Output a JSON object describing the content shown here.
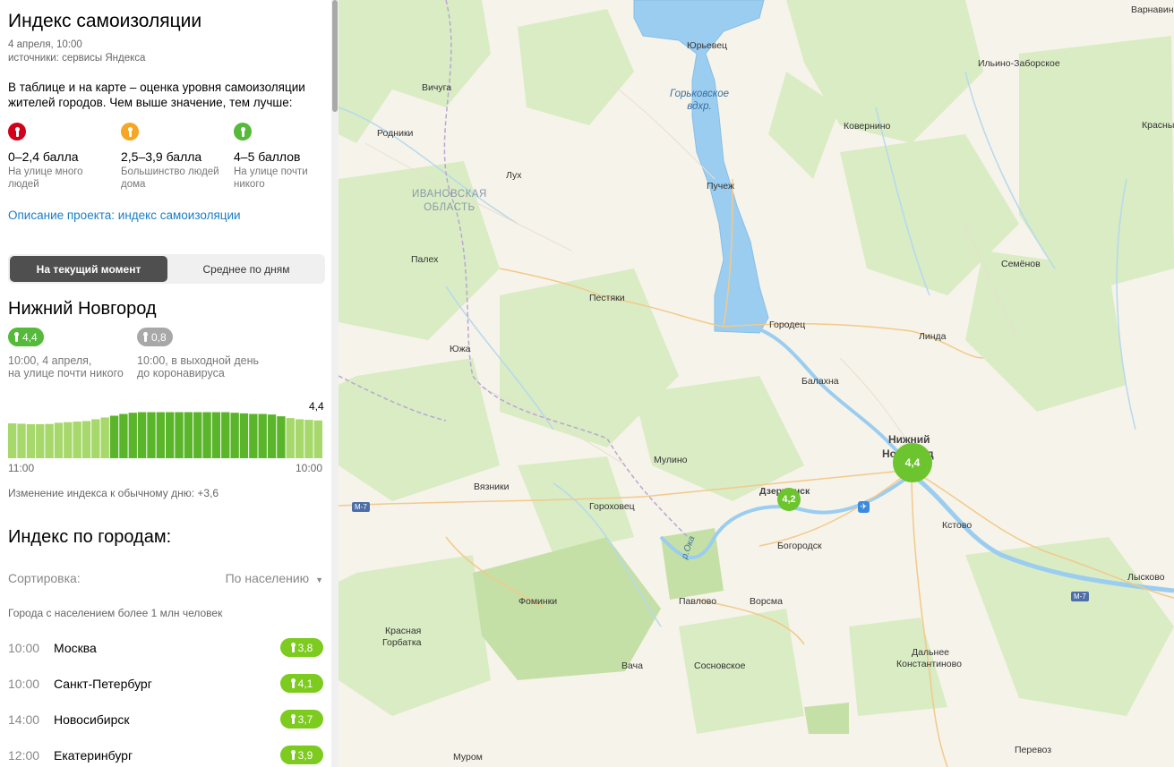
{
  "panel": {
    "title": "Индекс самоизоляции",
    "date": "4 апреля, 10:00",
    "sources": "источники: сервисы Яндекса",
    "description": "В таблице и на карте – оценка уровня самоизоляции жителей городов. Чем выше значение, тем лучше:",
    "legend": [
      {
        "range": "0–2,4 балла",
        "desc": "На улице много людей",
        "color": "#d0021b",
        "icon": "person-icon"
      },
      {
        "range": "2,5–3,9 балла",
        "desc": "Большинство людей дома",
        "color": "#f5a623",
        "icon": "person-icon"
      },
      {
        "range": "4–5 баллов",
        "desc": "На улице почти никого",
        "color": "#55b93a",
        "icon": "person-icon"
      }
    ],
    "project_link": "Описание проекта: индекс самоизоляции",
    "switch": {
      "current": "На текущий момент",
      "daily": "Среднее по дням"
    },
    "city": {
      "name": "Нижний Новгород",
      "current_value": "4,4",
      "current_caption_1": "10:00, 4 апреля,",
      "current_caption_2": "на улице почти никого",
      "base_value": "0,8",
      "base_caption_1": "10:00, в выходной день",
      "base_caption_2": "до коронавируса"
    },
    "change_text": "Изменение индекса к обычному дню: +3,6",
    "cities_title": "Индекс по городам:",
    "sort_label": "Сортировка:",
    "sort_value": "По населению",
    "group_label": "Города с населением более 1 млн человек",
    "rows": [
      {
        "time": "10:00",
        "name": "Москва",
        "value": "3,8"
      },
      {
        "time": "10:00",
        "name": "Санкт-Петербург",
        "value": "4,1"
      },
      {
        "time": "14:00",
        "name": "Новосибирск",
        "value": "3,7"
      },
      {
        "time": "12:00",
        "name": "Екатеринбург",
        "value": "3,9"
      }
    ]
  },
  "chart_data": {
    "type": "bar",
    "x_start_label": "11:00",
    "x_end_label": "10:00",
    "last_value_label": "4,4",
    "values": [
      2.95,
      2.92,
      2.88,
      2.88,
      2.9,
      3.0,
      3.05,
      3.1,
      3.15,
      3.3,
      3.45,
      3.6,
      3.75,
      3.85,
      3.9,
      3.9,
      3.9,
      3.9,
      3.9,
      3.9,
      3.9,
      3.9,
      3.9,
      3.9,
      3.85,
      3.8,
      3.75,
      3.75,
      3.7,
      3.55,
      3.4,
      3.3,
      3.25,
      3.2
    ],
    "ylim": [
      0,
      5
    ],
    "colors": {
      "low": "#a6d86b",
      "high": "#5ab52a"
    }
  },
  "map": {
    "region_label": [
      "ИВАНОВСКАЯ",
      "ОБЛАСТЬ"
    ],
    "water_label": [
      "Горьковское",
      "вдхр."
    ],
    "road_label": "М-7",
    "oka_label": "р.Ока",
    "markers": [
      {
        "label": "Нижний Новгород",
        "value": "4,4",
        "color": "#6cc42e"
      },
      {
        "label": "Дзержинск",
        "value": "4,2",
        "color": "#6cc42e"
      }
    ],
    "places": [
      "Варнавино",
      "Юрьевец",
      "Вичуга",
      "Ильино-Заборское",
      "Родники",
      "Ковернино",
      "Красные Баки",
      "Лух",
      "Пучеж",
      "Семёнов",
      "Палех",
      "Пестяки",
      "Городец",
      "Линда",
      "Южа",
      "Балахна",
      "Нижний",
      "Новгород",
      "Мулино",
      "Вязники",
      "Гороховец",
      "Дзержинск",
      "Кстово",
      "Богородск",
      "Фоминки",
      "Павлово",
      "Ворсма",
      "Лысково",
      "Красная",
      "Горбатка",
      "Вача",
      "Сосновское",
      "Дальнее",
      "Константиново",
      "Муром",
      "Перевоз"
    ]
  }
}
